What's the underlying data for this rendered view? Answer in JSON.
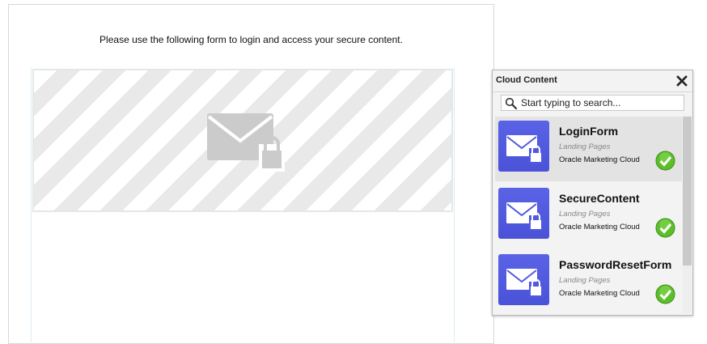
{
  "page": {
    "intro_text": "Please use the following form to login and access your secure content."
  },
  "panel": {
    "title": "Cloud Content",
    "close_icon": "close-icon",
    "search": {
      "placeholder": "Start typing to search...",
      "value": ""
    },
    "items": [
      {
        "name": "LoginForm",
        "type": "Landing Pages",
        "source": "Oracle Marketing Cloud",
        "icon": "locked-envelope-icon",
        "status_icon": "check-icon",
        "selected": true
      },
      {
        "name": "SecureContent",
        "type": "Landing Pages",
        "source": "Oracle Marketing Cloud",
        "icon": "locked-envelope-icon",
        "status_icon": "check-icon",
        "selected": false
      },
      {
        "name": "PasswordResetForm",
        "type": "Landing Pages",
        "source": "Oracle Marketing Cloud",
        "icon": "locked-envelope-icon",
        "status_icon": "check-icon",
        "selected": false
      }
    ]
  },
  "colors": {
    "thumb": "#5159e0",
    "check": "#4caf28",
    "stripe": "#e9e9e9"
  }
}
